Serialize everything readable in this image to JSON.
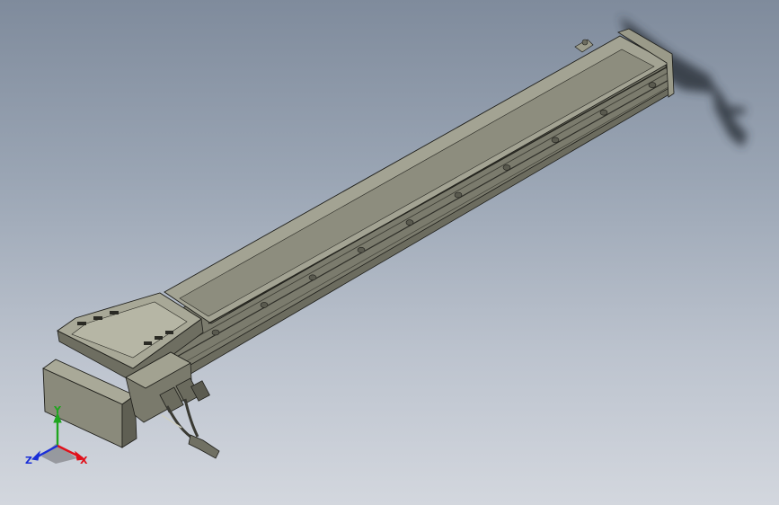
{
  "viewport": {
    "background_top": "#7f8b9c",
    "background_bottom": "#d3d7de"
  },
  "model": {
    "body_color": "#8f8f80",
    "body_dark": "#5d5d52",
    "body_light": "#b3b3a2",
    "edge_color": "#1e1e1a",
    "shadow_color": "#3a4048"
  },
  "triad": {
    "x_label": "X",
    "y_label": "Y",
    "z_label": "Z",
    "x_color": "#e0101a",
    "y_color": "#1fa51f",
    "z_color": "#1a2fd8"
  }
}
